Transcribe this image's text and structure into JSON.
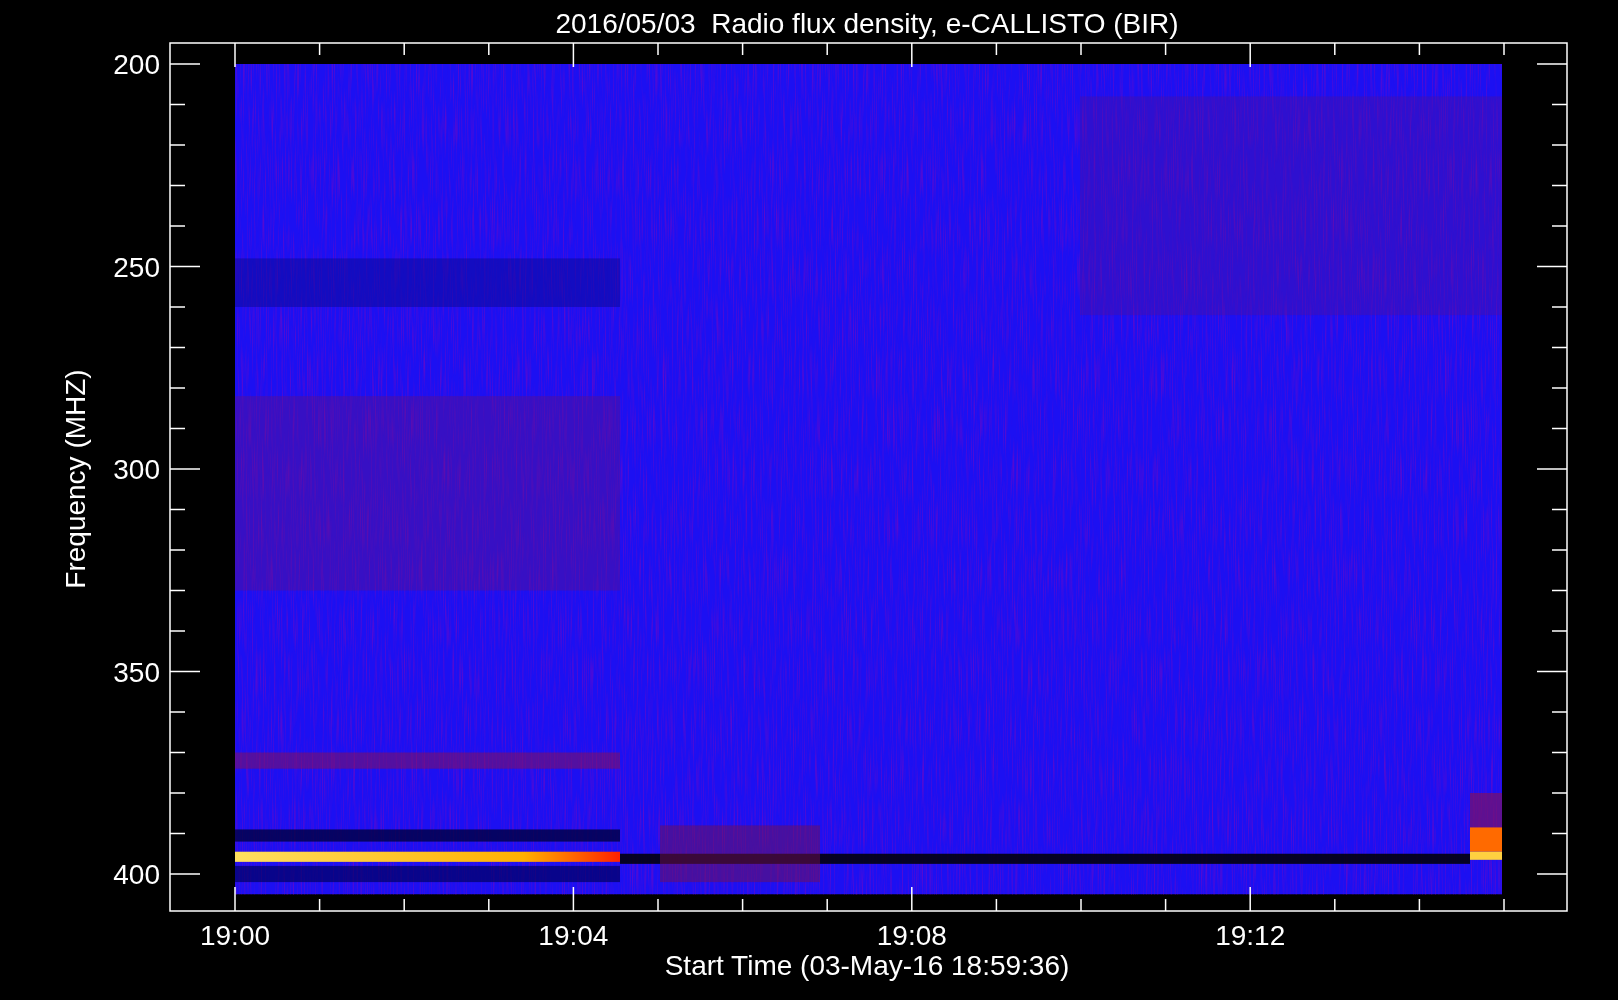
{
  "title": "2016/05/03  Radio flux density, e-CALLISTO (BIR)",
  "x_axis": {
    "label": "Start Time (03-May-16 18:59:36)",
    "ticks": [
      "19:00",
      "19:04",
      "19:08",
      "19:12"
    ]
  },
  "y_axis": {
    "label": "Frequency (MHZ)",
    "ticks": [
      "200",
      "250",
      "300",
      "350",
      "400"
    ]
  }
}
